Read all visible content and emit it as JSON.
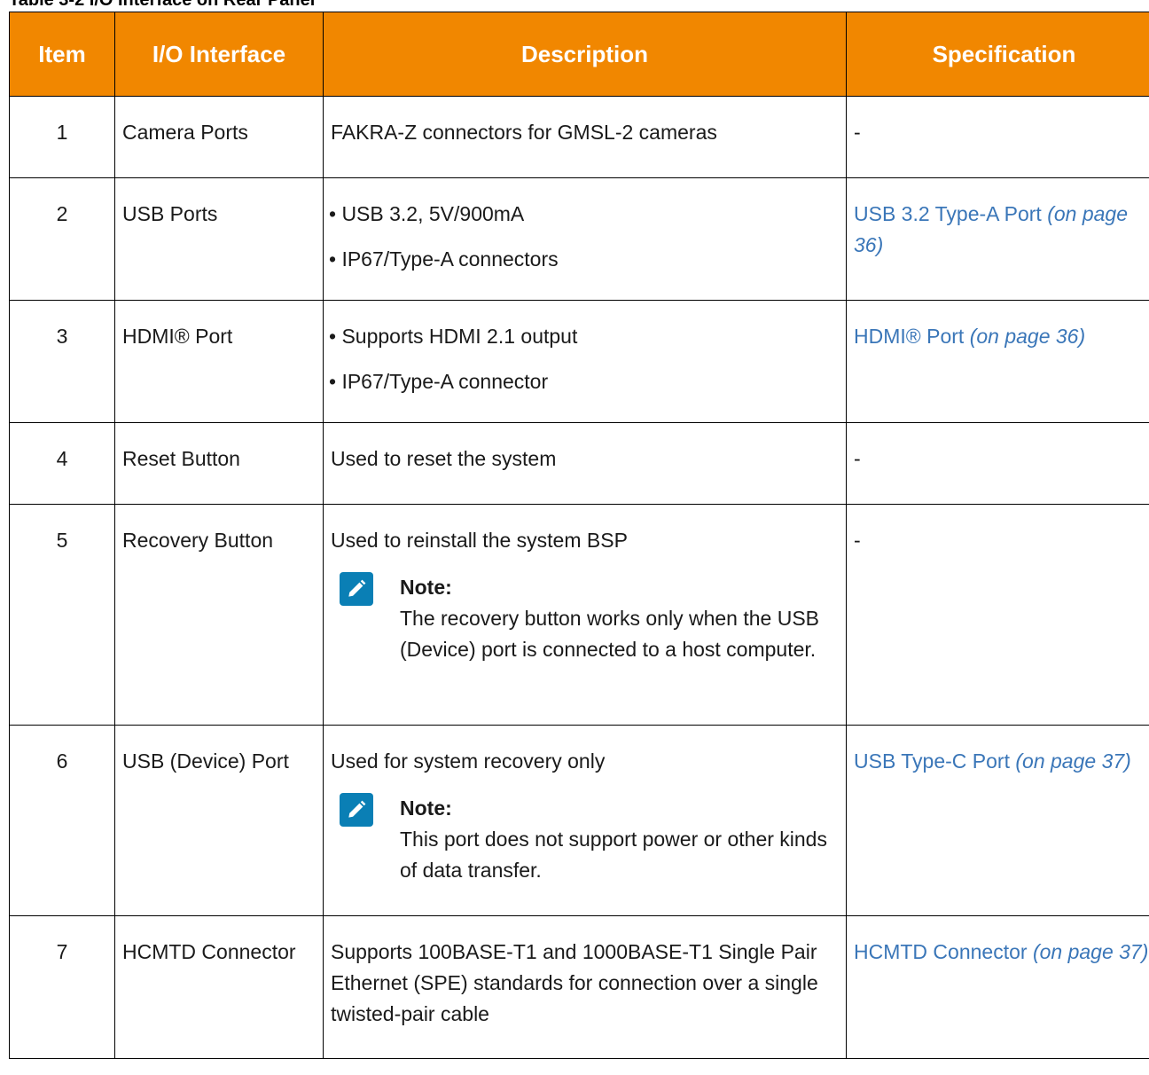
{
  "caption": "Table 3-2 I/O Interface on Rear Panel",
  "table": {
    "headers": {
      "item": "Item",
      "io": "I/O Interface",
      "description": "Description",
      "specification": "Specification"
    },
    "rows": [
      {
        "item": "1",
        "io": "Camera Ports",
        "description": "FAKRA-Z connectors for GMSL-2 cameras",
        "spec": "-"
      },
      {
        "item": "2",
        "io": "USB Ports",
        "bullets": [
          "• USB 3.2, 5V/900mA",
          "• IP67/Type-A connectors"
        ],
        "spec_link": "USB 3.2 Type-A Port",
        "spec_page": "(on page 36)"
      },
      {
        "item": "3",
        "io": "HDMI® Port",
        "bullets": [
          "• Supports HDMI 2.1 output",
          "• IP67/Type-A connector"
        ],
        "spec_link": "HDMI® Port",
        "spec_page": "(on page 36)"
      },
      {
        "item": "4",
        "io": "Reset Button",
        "description": "Used to reset the system",
        "spec": "-"
      },
      {
        "item": "5",
        "io": "Recovery Button",
        "description": "Used to reinstall the system BSP",
        "note_title": "Note:",
        "note_text": "The recovery button works only when the USB (Device) port is connected to a host computer.",
        "spec": "-"
      },
      {
        "item": "6",
        "io": "USB (Device) Port",
        "description": "Used for system recovery only",
        "note_title": "Note:",
        "note_text": "This port does not support power or other kinds of data transfer.",
        "spec_link": "USB Type-C Port",
        "spec_page": "(on page 37)"
      },
      {
        "item": "7",
        "io": "HCMTD Connector",
        "description": "Supports 100BASE-T1 and 1000BASE-T1 Single Pair Ethernet (SPE) standards for connection over a single twisted-pair cable",
        "spec_link": "HCMTD Connector",
        "spec_page": "(on page 37)"
      }
    ]
  },
  "colors": {
    "header_bg": "#f18700",
    "link": "#3a76b8",
    "note_icon_bg": "#0a7fb5"
  },
  "icons": {
    "note": "pencil-icon"
  }
}
